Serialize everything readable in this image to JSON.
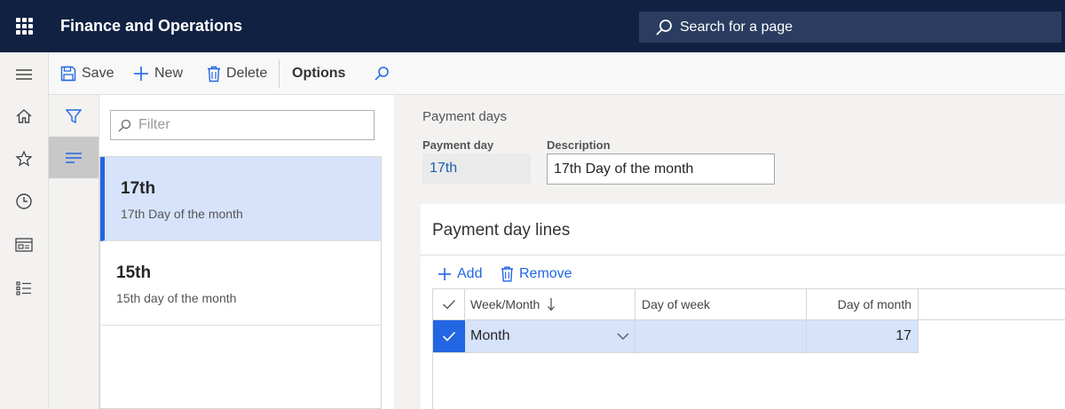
{
  "app": {
    "title": "Finance and Operations"
  },
  "search": {
    "placeholder": "Search for a page"
  },
  "nav": {
    "items": [
      {
        "name": "menu-icon"
      },
      {
        "name": "home-icon"
      },
      {
        "name": "star-icon"
      },
      {
        "name": "clock-icon"
      },
      {
        "name": "workspace-icon"
      },
      {
        "name": "modules-icon"
      }
    ]
  },
  "toolbar": {
    "save_label": "Save",
    "new_label": "New",
    "delete_label": "Delete",
    "options_label": "Options"
  },
  "list": {
    "filter_placeholder": "Filter",
    "items": [
      {
        "title": "17th",
        "subtitle": "17th Day of the month",
        "selected": true
      },
      {
        "title": "15th",
        "subtitle": "15th day of the month",
        "selected": false
      }
    ]
  },
  "details": {
    "caption": "Payment days",
    "payment_day_label": "Payment day",
    "payment_day_value": "17th",
    "description_label": "Description",
    "description_value": "17th Day of the month"
  },
  "lines": {
    "title": "Payment day lines",
    "add_label": "Add",
    "remove_label": "Remove",
    "columns": [
      "Week/Month",
      "Day of week",
      "Day of month"
    ],
    "rows": [
      {
        "week_month": "Month",
        "day_of_week": "",
        "day_of_month": "17"
      }
    ]
  },
  "colors": {
    "header_bg": "#102142",
    "accent": "#2266e3",
    "selection_bg": "#d6e3fa"
  }
}
